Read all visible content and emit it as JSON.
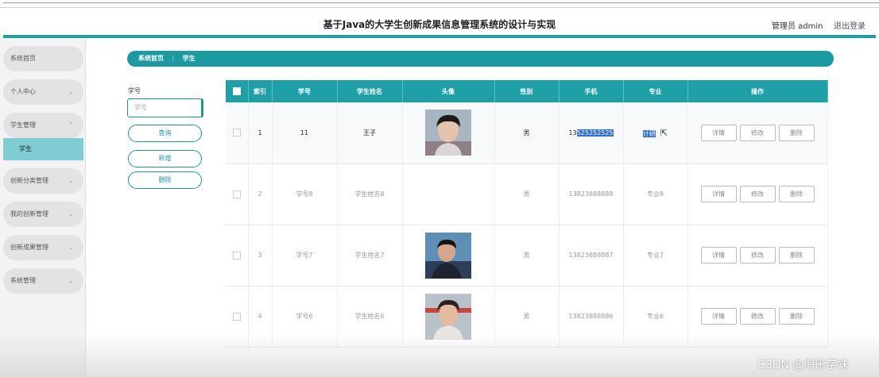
{
  "header": {
    "title": "基于Java的大学生创新成果信息管理系统的设计与实现",
    "admin_label": "管理员 admin",
    "logout_label": "退出登录"
  },
  "sidebar": {
    "items": [
      {
        "label": "系统首页"
      },
      {
        "label": "个人中心"
      },
      {
        "label": "学生管理"
      },
      {
        "label": "学生"
      },
      {
        "label": "创新分类管理"
      },
      {
        "label": "我的创新管理"
      },
      {
        "label": "创新成果管理"
      },
      {
        "label": "系统管理"
      }
    ]
  },
  "breadcrumb": {
    "home": "系统首页",
    "separator": "⋮",
    "current": "学生"
  },
  "search": {
    "label": "学号",
    "placeholder": "学号",
    "query_label": "查询",
    "add_label": "新增",
    "delete_label": "删除"
  },
  "table": {
    "headers": [
      "索引",
      "学号",
      "学生姓名",
      "头像",
      "性别",
      "手机",
      "专业",
      "操作"
    ],
    "rows": [
      {
        "index": "1",
        "id": "11",
        "name": "王子",
        "gender": "男",
        "phone_prefix": "13",
        "phone_selected": "525252525",
        "major": "计研"
      },
      {
        "index": "2",
        "id": "学号8",
        "name": "学生姓名8",
        "gender": "男",
        "phone": "13823888888",
        "major": "专业8"
      },
      {
        "index": "3",
        "id": "学号7",
        "name": "学生姓名7",
        "gender": "男",
        "phone": "13823888887",
        "major": "专业7"
      },
      {
        "index": "4",
        "id": "学号6",
        "name": "学生姓名6",
        "gender": "男",
        "phone": "13823888886",
        "major": "专业6"
      }
    ],
    "ops": {
      "detail": "详情",
      "edit": "修改",
      "delete": "删除"
    }
  },
  "watermark": "CSDN @海彤学妹",
  "colors": {
    "accent": "#1fa0a8",
    "selection": "#2f6de0",
    "active_menu": "#7fcdd2"
  }
}
